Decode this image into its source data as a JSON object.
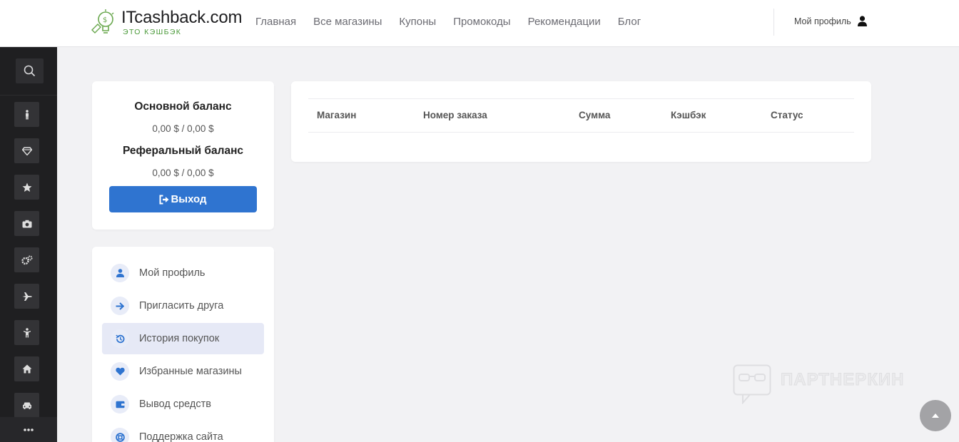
{
  "header": {
    "logo_title": "ITcashback.com",
    "logo_subtitle": "ЭТО КЭШБЭК",
    "nav": [
      "Главная",
      "Все магазины",
      "Купоны",
      "Промокоды",
      "Рекомендации",
      "Блог"
    ],
    "profile_label": "Мой профиль"
  },
  "side_bar": {
    "icons": [
      "search-icon",
      "male-icon",
      "diamond-icon",
      "star-icon",
      "camera-icon",
      "cogs-icon",
      "plane-icon",
      "child-icon",
      "home-icon",
      "car-icon",
      "more-icon"
    ]
  },
  "balance": {
    "main_title": "Основной баланс",
    "main_value": "0,00 $ / 0,00 $",
    "ref_title": "Реферальный баланс",
    "ref_value": "0,00 $ / 0,00 $",
    "logout_label": "Выход"
  },
  "menu": {
    "items": [
      {
        "label": "Мой профиль",
        "icon": "user-icon"
      },
      {
        "label": "Пригласить друга",
        "icon": "arrow-right-icon"
      },
      {
        "label": "История покупок",
        "icon": "history-icon",
        "active": true
      },
      {
        "label": "Избранные магазины",
        "icon": "heart-icon"
      },
      {
        "label": "Вывод средств",
        "icon": "wallet-icon"
      },
      {
        "label": "Поддержка сайта",
        "icon": "lifebuoy-icon"
      }
    ]
  },
  "table": {
    "columns": [
      "Магазин",
      "Номер заказа",
      "Сумма",
      "Кэшбэк",
      "Статус"
    ],
    "rows": []
  },
  "watermark": "ПАРТНЕРКИН",
  "colors": {
    "accent": "#2f74d0",
    "logo_green": "#4b9a3a",
    "sidebar_bg": "#1f1f21",
    "active_item_bg": "#e6e9f6"
  }
}
